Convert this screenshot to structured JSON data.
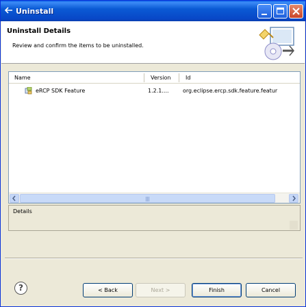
{
  "window": {
    "title": "Uninstall"
  },
  "header": {
    "title": "Uninstall Details",
    "description": "Review and confirm the items to be uninstalled."
  },
  "table": {
    "columns": [
      "Name",
      "Version",
      "Id"
    ],
    "rows": [
      {
        "name": "eRCP SDK Feature",
        "version": "1.2.1....",
        "id": "org.eclipse.ercp.sdk.feature.featur",
        "icon": "feature-icon"
      }
    ]
  },
  "details": {
    "label": "Details"
  },
  "buttons": {
    "back": "< Back",
    "next": "Next >",
    "finish": "Finish",
    "cancel": "Cancel"
  },
  "colors": {
    "title_bar": "#0a5ad4",
    "dialog_bg": "#ece9d8"
  }
}
